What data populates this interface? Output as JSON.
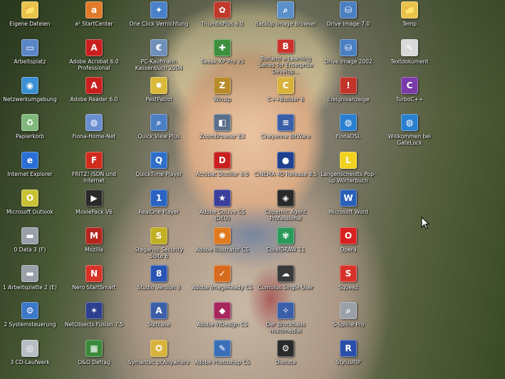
{
  "desktop": {
    "columns": [
      [
        {
          "label": "Eigene Dateien",
          "icon": "folder-icon",
          "color": "#e8c34a",
          "glyph": "📁"
        },
        {
          "label": "Arbeitsplatz",
          "icon": "computer-icon",
          "color": "#5b86c6",
          "glyph": "▭"
        },
        {
          "label": "Netzwerkumgebung",
          "icon": "network-icon",
          "color": "#3b8fd4",
          "glyph": "◉"
        },
        {
          "label": "Papierkorb",
          "icon": "recycle-bin-icon",
          "color": "#7fb87a",
          "glyph": "♻"
        },
        {
          "label": "Internet Explorer",
          "icon": "internet-explorer-icon",
          "color": "#2a6fd6",
          "glyph": "e"
        },
        {
          "label": "Microsoft Outlook",
          "icon": "outlook-icon",
          "color": "#c9c235",
          "glyph": "O"
        },
        {
          "label": "0 Data 3 (F)",
          "icon": "drive-icon",
          "color": "#9aa0a8",
          "glyph": "▬"
        },
        {
          "label": "1 Arbeitsplatte 2 (E)",
          "icon": "drive-icon",
          "color": "#9aa0a8",
          "glyph": "▬"
        },
        {
          "label": "2 Systemsteuerung",
          "icon": "control-panel-icon",
          "color": "#3c78c8",
          "glyph": "⚙"
        },
        {
          "label": "3 CD-Laufwerk",
          "icon": "cd-drive-icon",
          "color": "#b9bdc4",
          "glyph": "◎"
        }
      ],
      [
        {
          "label": "a² StartCenter",
          "icon": "start-center-icon",
          "color": "#e07b2a",
          "glyph": "a"
        },
        {
          "label": "Adobe Acrobat 6.0 Professional",
          "icon": "acrobat-icon",
          "color": "#c8201e",
          "glyph": "A"
        },
        {
          "label": "Adobe Reader 6.0",
          "icon": "adobe-reader-icon",
          "color": "#c8201e",
          "glyph": "A"
        },
        {
          "label": "Fiona-Home-Net",
          "icon": "fiona-icon",
          "color": "#6a8fd0",
          "glyph": "◍"
        },
        {
          "label": "FRITZ! ISDN und Internet",
          "icon": "fritz-icon",
          "color": "#d12b1e",
          "glyph": "F"
        },
        {
          "label": "MoviePack V6",
          "icon": "moviepack-icon",
          "color": "#2a2a2a",
          "glyph": "▶"
        },
        {
          "label": "Mozilla",
          "icon": "mozilla-icon",
          "color": "#b3261e",
          "glyph": "M"
        },
        {
          "label": "Nero StartSmart",
          "icon": "nero-icon",
          "color": "#d8342a",
          "glyph": "N"
        },
        {
          "label": "NetObjects Fusion 7.5",
          "icon": "netobjects-icon",
          "color": "#2d3f8f",
          "glyph": "✶"
        },
        {
          "label": "O&O Defrag",
          "icon": "defrag-icon",
          "color": "#3a8a3a",
          "glyph": "▦"
        }
      ],
      [
        {
          "label": "One Click Vernichtung",
          "icon": "shredder-icon",
          "color": "#4a82c9",
          "glyph": "✦"
        },
        {
          "label": "PC-Kaufmann Kassenbuch 2004",
          "icon": "pc-kaufmann-icon",
          "color": "#6e8fb8",
          "glyph": "€"
        },
        {
          "label": "PestPatrol",
          "icon": "pestpatrol-icon",
          "color": "#d9b93a",
          "glyph": "✸"
        },
        {
          "label": "Quick View Plus",
          "icon": "magnifier-icon",
          "color": "#4d7fc4",
          "glyph": "⌕"
        },
        {
          "label": "QuickTime Player",
          "icon": "quicktime-icon",
          "color": "#2f6fc9",
          "glyph": "Q"
        },
        {
          "label": "RealOne Player",
          "icon": "realone-icon",
          "color": "#2a64c2",
          "glyph": "1"
        },
        {
          "label": "Steganos Security Suite 6",
          "icon": "steganos-icon",
          "color": "#c2b022",
          "glyph": "S"
        },
        {
          "label": "Studio Version 8",
          "icon": "studio-icon",
          "color": "#2a55b5",
          "glyph": "8"
        },
        {
          "label": "Suitcase",
          "icon": "suitcase-icon",
          "color": "#3c5fa8",
          "glyph": "A"
        },
        {
          "label": "Symantec pcAnywhere",
          "icon": "pcanywhere-icon",
          "color": "#d8b23a",
          "glyph": "✪"
        }
      ],
      [
        {
          "label": "ThumbsPlus 6.0",
          "icon": "thumbsplus-icon",
          "color": "#c0392b",
          "glyph": "✿"
        },
        {
          "label": "Tweak-XP Pro v3",
          "icon": "tweak-xp-icon",
          "color": "#3d8f3d",
          "glyph": "✚"
        },
        {
          "label": "Winzip",
          "icon": "winzip-icon",
          "color": "#b88a2a",
          "glyph": "Z"
        },
        {
          "label": "ZoomBrowser EX",
          "icon": "zoombrowser-icon",
          "color": "#5a6f8a",
          "glyph": "◧"
        },
        {
          "label": "Acrobat Distiller 6.0",
          "icon": "distiller-icon",
          "color": "#c8201e",
          "glyph": "D"
        },
        {
          "label": "Adobe GoLive CS (DEU)",
          "icon": "golive-icon",
          "color": "#3b3f9a",
          "glyph": "★"
        },
        {
          "label": "Adobe Illustrator CS",
          "icon": "illustrator-icon",
          "color": "#e07a1e",
          "glyph": "✺"
        },
        {
          "label": "Adobe ImageReady CS",
          "icon": "imageready-icon",
          "color": "#d86a1e",
          "glyph": "✓"
        },
        {
          "label": "Adobe InDesign CS",
          "icon": "indesign-icon",
          "color": "#a8275e",
          "glyph": "◆"
        },
        {
          "label": "Adobe Photoshop CS",
          "icon": "photoshop-icon",
          "color": "#3a6fb8",
          "glyph": "✎"
        }
      ],
      [
        {
          "label": "Backup Image Browser",
          "icon": "backup-browser-icon",
          "color": "#5a8fc9",
          "glyph": "⌕"
        },
        {
          "label": "Borland e-Learning Series for Enterprise Develop...",
          "icon": "borland-icon",
          "color": "#c9322a",
          "glyph": "B"
        },
        {
          "label": "C++Builder 6",
          "icon": "cppbuilder-icon",
          "color": "#d8b23a",
          "glyph": "C"
        },
        {
          "label": "Cheyenne BitWare",
          "icon": "bitware-icon",
          "color": "#3a5fa8",
          "glyph": "≡"
        },
        {
          "label": "CINEMA 4D Release 8.5",
          "icon": "cinema4d-icon",
          "color": "#1f3f8f",
          "glyph": "●"
        },
        {
          "label": "Copernic Agent Professional",
          "icon": "copernic-icon",
          "color": "#2a2a2a",
          "glyph": "◈"
        },
        {
          "label": "CorelDRAW 11",
          "icon": "coreldraw-icon",
          "color": "#2a9a5a",
          "glyph": "✾"
        },
        {
          "label": "Cumulus Single User",
          "icon": "cumulus-icon",
          "color": "#3a3a3a",
          "glyph": "☁"
        },
        {
          "label": "Der Brockhaus multimedial",
          "icon": "brockhaus-icon",
          "color": "#3a5fa8",
          "glyph": "✧"
        },
        {
          "label": "Dienste",
          "icon": "services-icon",
          "color": "#2a2a2a",
          "glyph": "⚙"
        }
      ],
      [
        {
          "label": "Drive Image 7.0",
          "icon": "drive-image-icon",
          "color": "#4a7fc2",
          "glyph": "⛁"
        },
        {
          "label": "Drive Image 2002",
          "icon": "drive-image-2002-icon",
          "color": "#4a7fc2",
          "glyph": "⛁"
        },
        {
          "label": "Ereignisanzeige",
          "icon": "event-viewer-icon",
          "color": "#c2342a",
          "glyph": "!"
        },
        {
          "label": "FionaDSL",
          "icon": "fionadsl-icon",
          "color": "#2a7fd0",
          "glyph": "◍"
        },
        {
          "label": "Langenscheidts Pop-up Wörterbuch",
          "icon": "langenscheidt-icon",
          "color": "#f2d21e",
          "glyph": "L"
        },
        {
          "label": "Microsoft Word",
          "icon": "word-icon",
          "color": "#2b5fb8",
          "glyph": "W"
        },
        {
          "label": "Opera",
          "icon": "opera-icon",
          "color": "#d82020",
          "glyph": "O"
        },
        {
          "label": "Squeez",
          "icon": "squeez-icon",
          "color": "#d8322a",
          "glyph": "S"
        },
        {
          "label": "S-Spline Pro",
          "icon": "s-spline-icon",
          "color": "#9aa0a8",
          "glyph": "⌕"
        },
        {
          "label": "StylusRIP",
          "icon": "stylusrip-icon",
          "color": "#2a4fa8",
          "glyph": "R"
        }
      ],
      [
        {
          "label": "Temp",
          "icon": "folder-icon",
          "color": "#e8c34a",
          "glyph": "📁"
        },
        {
          "label": "Textdokument",
          "icon": "text-document-icon",
          "color": "#d8d8d8",
          "glyph": "✎"
        },
        {
          "label": "TurboC++",
          "icon": "turboc-icon",
          "color": "#7a3aa8",
          "glyph": "C"
        },
        {
          "label": "Willkommen bei GateLock",
          "icon": "gatelock-icon",
          "color": "#2a7fd0",
          "glyph": "◍"
        }
      ]
    ],
    "cursor_icon": "mouse-pointer-icon"
  }
}
